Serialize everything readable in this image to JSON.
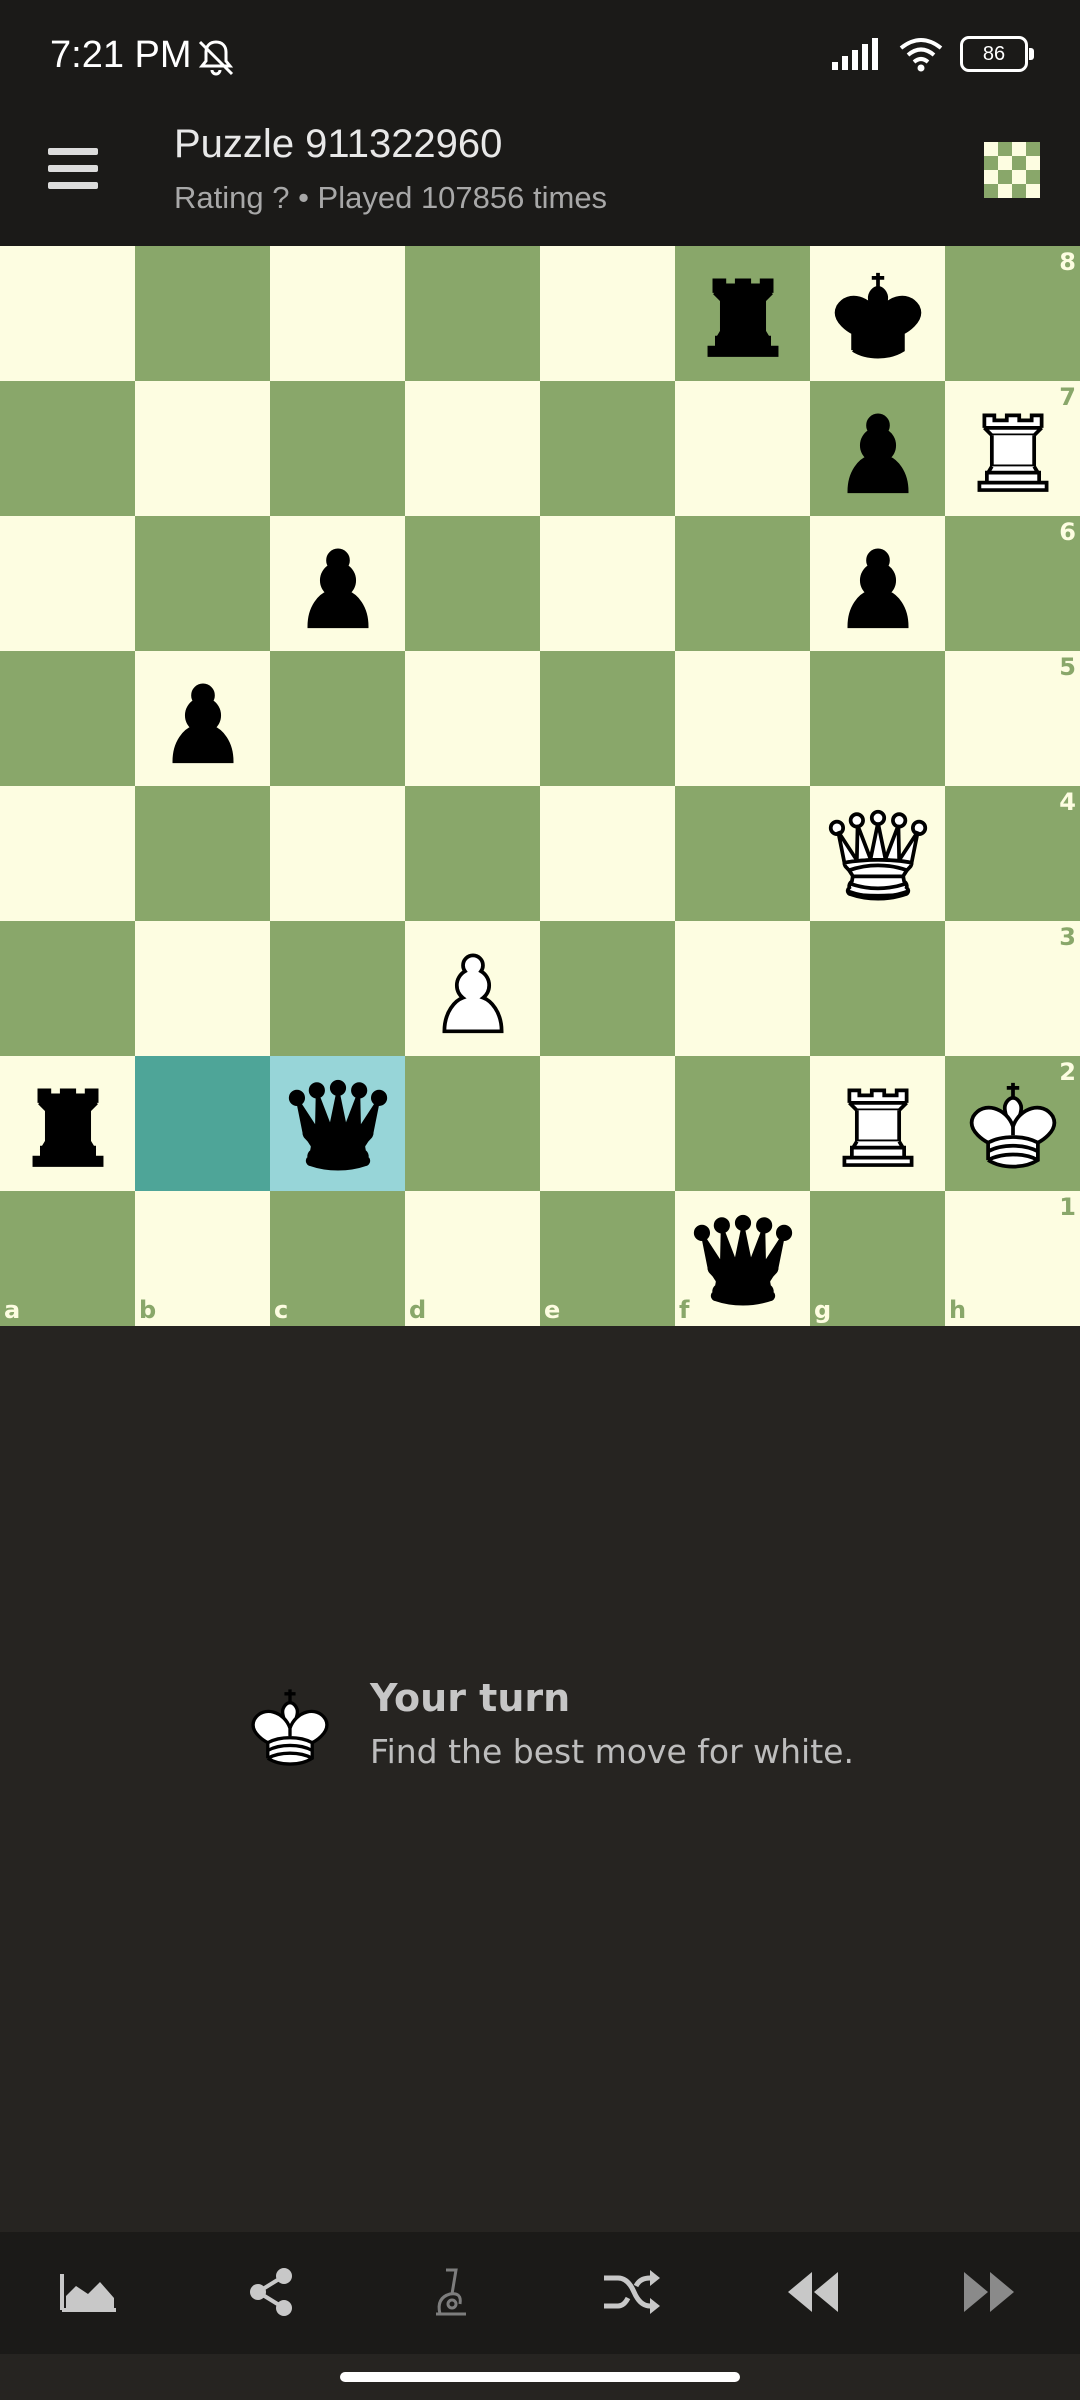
{
  "status": {
    "time": "7:21 PM",
    "battery": "86"
  },
  "header": {
    "title": "Puzzle 911322960",
    "subtitle": "Rating ? • Played 107856 times"
  },
  "board": {
    "ranks": [
      "8",
      "7",
      "6",
      "5",
      "4",
      "3",
      "2",
      "1"
    ],
    "files": [
      "a",
      "b",
      "c",
      "d",
      "e",
      "f",
      "g",
      "h"
    ],
    "pieces": {
      "f8": "bR",
      "g8": "bK",
      "g7": "bP",
      "h7": "wR",
      "c6": "bP",
      "g6": "bP",
      "b5": "bP",
      "g4": "wQ",
      "d3": "wP",
      "a2": "bR",
      "c2": "bQ",
      "g2": "wR",
      "h2": "wK",
      "f1": "bQ"
    },
    "last_move": {
      "from": "b2",
      "to": "c2"
    }
  },
  "turn": {
    "title": "Your turn",
    "description": "Find the best move for white."
  },
  "bottom_nav": [
    "chart-icon",
    "share-icon",
    "analysis-icon",
    "shuffle-icon",
    "previous-icon",
    "next-icon"
  ]
}
